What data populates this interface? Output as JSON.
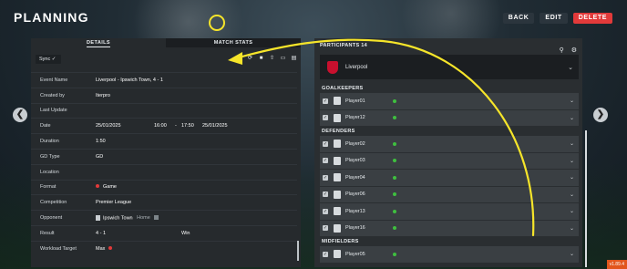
{
  "app": {
    "title": "PLANNING",
    "version": "v1.89.4"
  },
  "top_actions": {
    "back": "BACK",
    "edit": "EDIT",
    "delete": "DELETE"
  },
  "nav": {
    "prev": "❮",
    "next": "❯"
  },
  "left": {
    "tabs": [
      "DETAILS",
      "MATCH STATS"
    ],
    "sync_label": "Sync ✓",
    "toolbar_icons": [
      "refresh-icon",
      "video-icon",
      "upload-icon",
      "folder-icon",
      "document-icon"
    ],
    "fields": [
      {
        "label": "Event Name",
        "value": "Liverpool - Ipswich Town, 4 - 1"
      },
      {
        "label": "Created by",
        "value": "Iterpro"
      },
      {
        "label": "Last Update",
        "value": ""
      },
      {
        "label": "Date",
        "value": "25/01/2025",
        "start": "16:00",
        "sep": "-",
        "end": "17:50",
        "end_date": "25/01/2025"
      },
      {
        "label": "Duration",
        "value": "1:50"
      },
      {
        "label": "GD Type",
        "value": "GD"
      },
      {
        "label": "Location",
        "value": ""
      },
      {
        "label": "Format",
        "value": "Game"
      },
      {
        "label": "Competition",
        "value": "Premier League"
      },
      {
        "label": "Opponent",
        "value": "Ipswich Town",
        "extra": "Home"
      },
      {
        "label": "Result",
        "value": "4 - 1",
        "extra": "Win"
      },
      {
        "label": "Workload Target",
        "value": "Max"
      }
    ]
  },
  "right": {
    "header": "PARTICIPANTS 14",
    "team": "Liverpool",
    "groups": [
      {
        "name": "GOALKEEPERS",
        "players": [
          "Player01",
          "Player12"
        ]
      },
      {
        "name": "DEFENDERS",
        "players": [
          "Player02",
          "Player03",
          "Player04",
          "Player06",
          "Player13",
          "Player16"
        ]
      },
      {
        "name": "MIDFIELDERS",
        "players": [
          "Player05"
        ]
      }
    ]
  },
  "colors": {
    "accent": "#e23a3a",
    "highlight": "#f6e52a",
    "status_green": "#3fbf3f",
    "version_badge": "#e2551c"
  }
}
